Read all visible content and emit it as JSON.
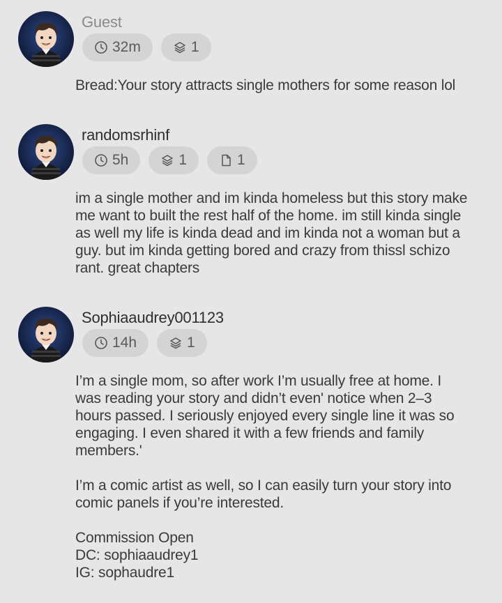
{
  "comments": [
    {
      "username": "Guest",
      "time": "32m",
      "layers": "1",
      "text": "Bread:Your story attracts single mothers for some reason lol"
    },
    {
      "username": "randomsrhinf",
      "time": "5h",
      "layers": "1",
      "pages": "1",
      "text": "im a single mother and im kinda homeless but this story make me want to built the rest half of the home. im still kinda single as well my life is kinda dead and im kinda not a woman but a guy. but im kinda getting bored and crazy from thissl schizo rant. great chapters"
    },
    {
      "username": "Sophiaaudrey001123",
      "time": "14h",
      "layers": "1",
      "paragraphs": [
        "I’m a single mom, so after work I’m usually free at home. I was reading your story and didn’t even' notice when 2–3 hours passed. I seriously enjoyed every single line it was so engaging. I even shared it with a few friends and family members.'",
        "I’m a comic artist as well, so I can easily turn your story into comic panels if you’re interested.",
        "Commission Open",
        "DC: sophiaaudrey1",
        "IG: sophaudre1"
      ]
    }
  ],
  "icons": {
    "time": "clock-icon",
    "layers": "layers-icon",
    "pages": "page-icon",
    "avatar": "user-avatar"
  },
  "colors": {
    "background": "#e6e6e6",
    "badge": "#d4d4d4",
    "text": "#3a3a3a",
    "guest_name": "#8a8a8a",
    "avatar_bg": "#1f2a44"
  }
}
